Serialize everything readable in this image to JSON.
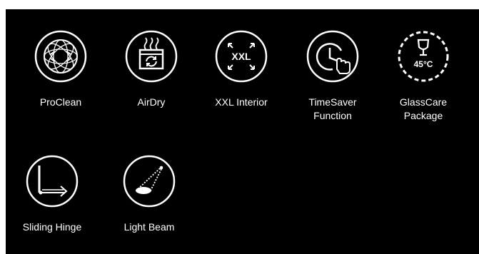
{
  "colors": {
    "background": "#000000",
    "foreground": "#ffffff",
    "page": "#ffffff"
  },
  "features": [
    {
      "icon": "proclean-icon",
      "label": "ProClean"
    },
    {
      "icon": "airdry-icon",
      "label": "AirDry"
    },
    {
      "icon": "xxl-interior-icon",
      "label": "XXL Interior",
      "icon_text": "XXL"
    },
    {
      "icon": "timesaver-icon",
      "label": "TimeSaver\nFunction"
    },
    {
      "icon": "glasscare-icon",
      "label": "GlassCare\nPackage",
      "icon_text": "45°C"
    },
    {
      "icon": "sliding-hinge-icon",
      "label": "Sliding Hinge"
    },
    {
      "icon": "light-beam-icon",
      "label": "Light Beam"
    }
  ]
}
